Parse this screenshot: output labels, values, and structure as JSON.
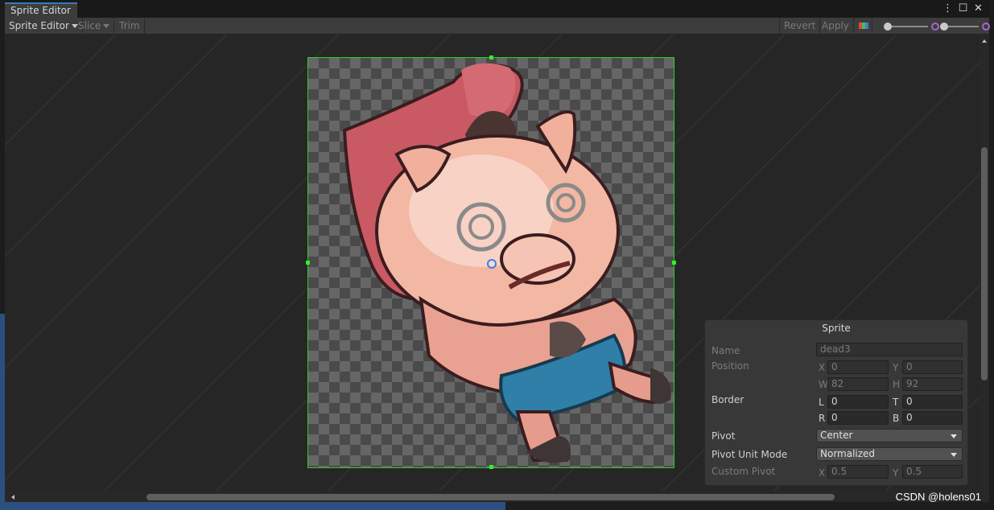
{
  "window": {
    "tab_title": "Sprite Editor",
    "controls": {
      "menu": "⋮",
      "maximize": "☐",
      "close": "✕"
    }
  },
  "toolbar": {
    "mode_label": "Sprite Editor",
    "slice_label": "Slice",
    "trim_label": "Trim",
    "revert_label": "Revert",
    "apply_label": "Apply"
  },
  "colors": {
    "selection_outline": "#2bd12b",
    "pivot": "#3d7fe0",
    "accent_tab": "#3a79bb"
  },
  "sprite_panel": {
    "title": "Sprite",
    "name_label": "Name",
    "name_value": "dead3",
    "position_label": "Position",
    "x_label": "X",
    "x_value": "0",
    "y_label": "Y",
    "y_value": "0",
    "w_label": "W",
    "w_value": "82",
    "h_label": "H",
    "h_value": "92",
    "border_label": "Border",
    "l_label": "L",
    "l_value": "0",
    "t_label": "T",
    "t_value": "0",
    "r_label": "R",
    "r_value": "0",
    "b_label": "B",
    "b_value": "0",
    "pivot_label": "Pivot",
    "pivot_value": "Center",
    "pivot_unit_label": "Pivot Unit Mode",
    "pivot_unit_value": "Normalized",
    "custom_pivot_label": "Custom Pivot",
    "cp_x_label": "X",
    "cp_x_value": "0.5",
    "cp_y_label": "Y",
    "cp_y_value": "0.5"
  },
  "watermark": "CSDN @holens01"
}
